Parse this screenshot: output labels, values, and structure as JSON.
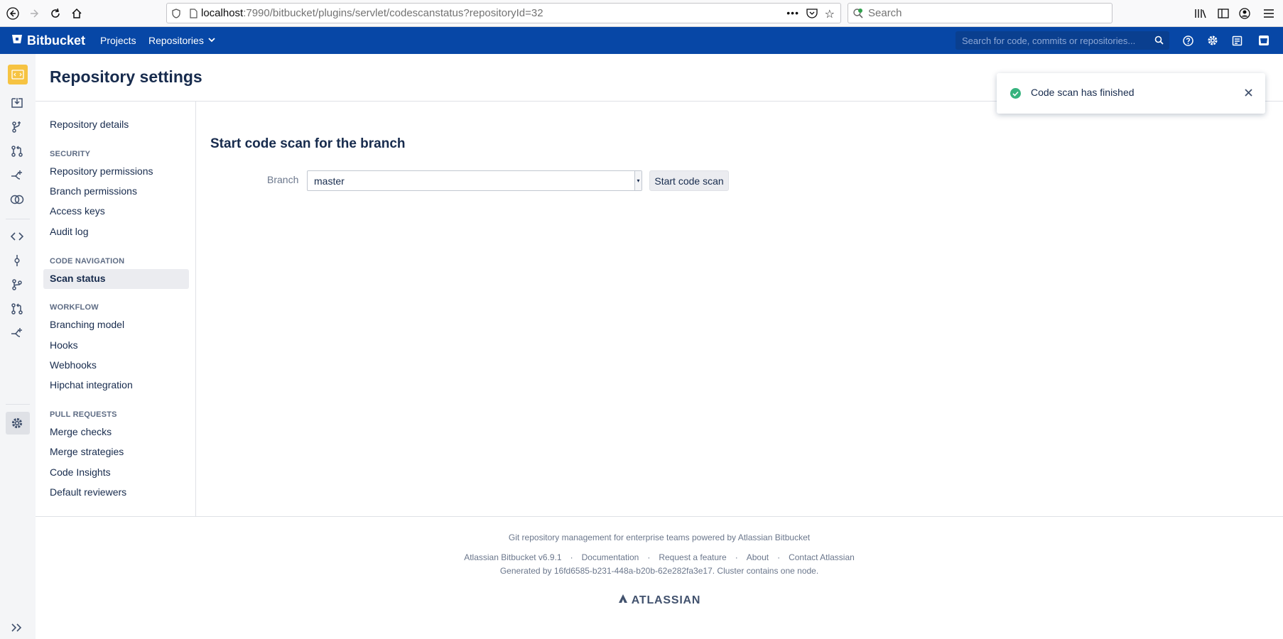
{
  "browser": {
    "url_host": "localhost",
    "url_path": ":7990/bitbucket/plugins/servlet/codescanstatus?repositoryId=32",
    "search_placeholder": "Search"
  },
  "header": {
    "logo": "Bitbucket",
    "nav": [
      "Projects",
      "Repositories"
    ],
    "search_placeholder": "Search for code, commits or repositories..."
  },
  "page": {
    "title": "Repository settings"
  },
  "settings_nav": {
    "top_item": "Repository details",
    "sections": [
      {
        "heading": "SECURITY",
        "items": [
          "Repository permissions",
          "Branch permissions",
          "Access keys",
          "Audit log"
        ]
      },
      {
        "heading": "CODE NAVIGATION",
        "items": [
          "Scan status"
        ]
      },
      {
        "heading": "WORKFLOW",
        "items": [
          "Branching model",
          "Hooks",
          "Webhooks",
          "Hipchat integration"
        ]
      },
      {
        "heading": "PULL REQUESTS",
        "items": [
          "Merge checks",
          "Merge strategies",
          "Code Insights",
          "Default reviewers"
        ]
      }
    ],
    "active_item": "Scan status"
  },
  "main": {
    "section_title": "Start code scan for the branch",
    "branch_label": "Branch",
    "branch_value": "master",
    "start_button": "Start code scan"
  },
  "flag": {
    "message": "Code scan has finished"
  },
  "footer": {
    "tagline": "Git repository management for enterprise teams powered by Atlassian Bitbucket",
    "links": [
      "Atlassian Bitbucket v6.9.1",
      "Documentation",
      "Request a feature",
      "About",
      "Contact Atlassian"
    ],
    "separator": "·",
    "generated": "Generated by 16fd6585-b231-448a-b20b-62e282fa3e17. Cluster contains one node.",
    "brand": "ATLASSIAN"
  },
  "colors": {
    "header": "#0747a6",
    "success": "#36b37e",
    "repo_avatar": "#f6c342"
  }
}
